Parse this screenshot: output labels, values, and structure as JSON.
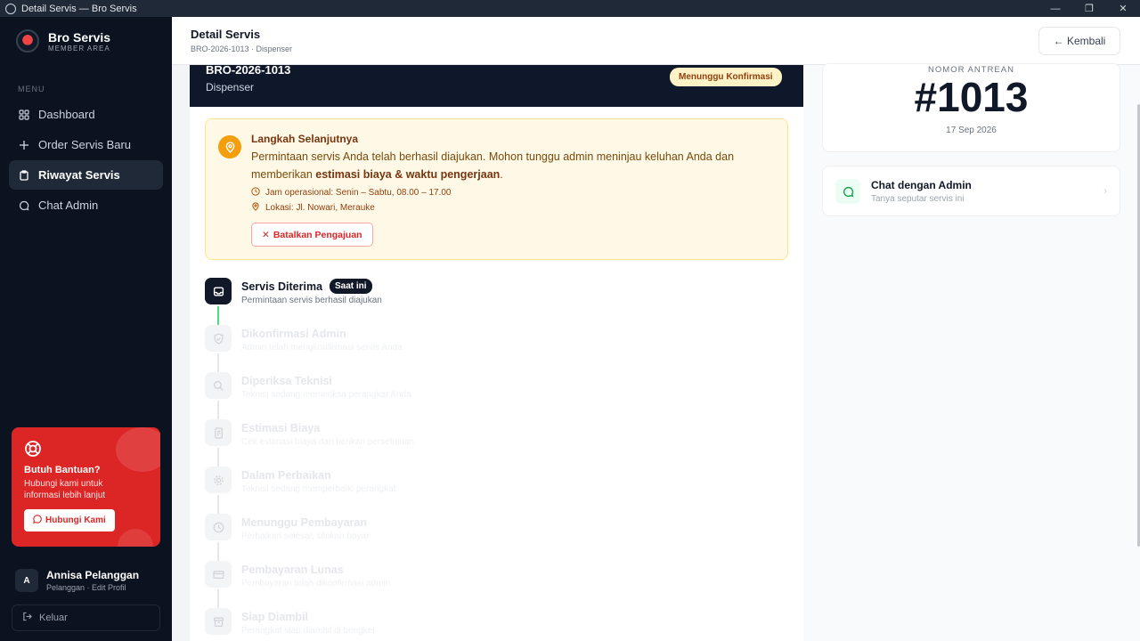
{
  "window": {
    "title": "Detail Servis — Bro Servis"
  },
  "sidebar": {
    "brand": {
      "name": "Bro Servis",
      "sub": "MEMBER AREA"
    },
    "menu_label": "MENU",
    "items": [
      {
        "label": "Dashboard",
        "icon": "grid-icon"
      },
      {
        "label": "Order Servis Baru",
        "icon": "plus-icon"
      },
      {
        "label": "Riwayat Servis",
        "icon": "clipboard-icon",
        "active": true
      },
      {
        "label": "Chat Admin",
        "icon": "chat-icon"
      }
    ],
    "help": {
      "title": "Butuh Bantuan?",
      "text": "Hubungi kami untuk informasi lebih lanjut",
      "button": "Hubungi Kami"
    },
    "user": {
      "initial": "A",
      "name": "Annisa Pelanggan",
      "sub": "Pelanggan · Edit Profil"
    },
    "logout": "Keluar"
  },
  "header": {
    "title": "Detail Servis",
    "subtitle": "BRO-2026-1013 · Dispenser",
    "back": "← Kembali"
  },
  "ticket": {
    "code": "BRO-2026-1013",
    "device": "Dispenser",
    "status": "Menunggu Konfirmasi"
  },
  "next_step": {
    "title": "Langkah Selanjutnya",
    "text_before": "Permintaan servis Anda telah berhasil diajukan. Mohon tunggu admin meninjau keluhan Anda dan memberikan ",
    "text_bold": "estimasi biaya & waktu pengerjaan",
    "text_after": ".",
    "hours": "Jam operasional: Senin – Sabtu, 08.00 – 17.00",
    "location": "Lokasi: Jl. Nowari, Merauke",
    "cancel": "Batalkan Pengajuan"
  },
  "timeline": {
    "current_badge": "Saat ini",
    "steps": [
      {
        "name": "Servis Diterima",
        "desc": "Permintaan servis berhasil diajukan",
        "icon": "inbox-icon"
      },
      {
        "name": "Dikonfirmasi Admin",
        "desc": "Admin telah mengkonfirmasi servis Anda",
        "icon": "shield-check-icon"
      },
      {
        "name": "Diperiksa Teknisi",
        "desc": "Teknisi sedang memeriksa perangkat Anda",
        "icon": "search-icon"
      },
      {
        "name": "Estimasi Biaya",
        "desc": "Cek estimasi biaya dan berikan persetujuan",
        "icon": "document-icon"
      },
      {
        "name": "Dalam Perbaikan",
        "desc": "Teknisi sedang memperbaiki perangkat",
        "icon": "gear-icon"
      },
      {
        "name": "Menunggu Pembayaran",
        "desc": "Perbaikan selesai, silakan bayar",
        "icon": "clock-icon"
      },
      {
        "name": "Pembayaran Lunas",
        "desc": "Pembayaran telah dikonfirmasi admin",
        "icon": "card-icon"
      },
      {
        "name": "Siap Diambil",
        "desc": "Perangkat siap diambil di bengkel",
        "icon": "box-icon"
      }
    ]
  },
  "queue": {
    "label": "NOMOR ANTREAN",
    "number": "#1013",
    "date": "17 Sep 2026"
  },
  "chat": {
    "title": "Chat dengan Admin",
    "sub": "Tanya seputar servis ini"
  }
}
